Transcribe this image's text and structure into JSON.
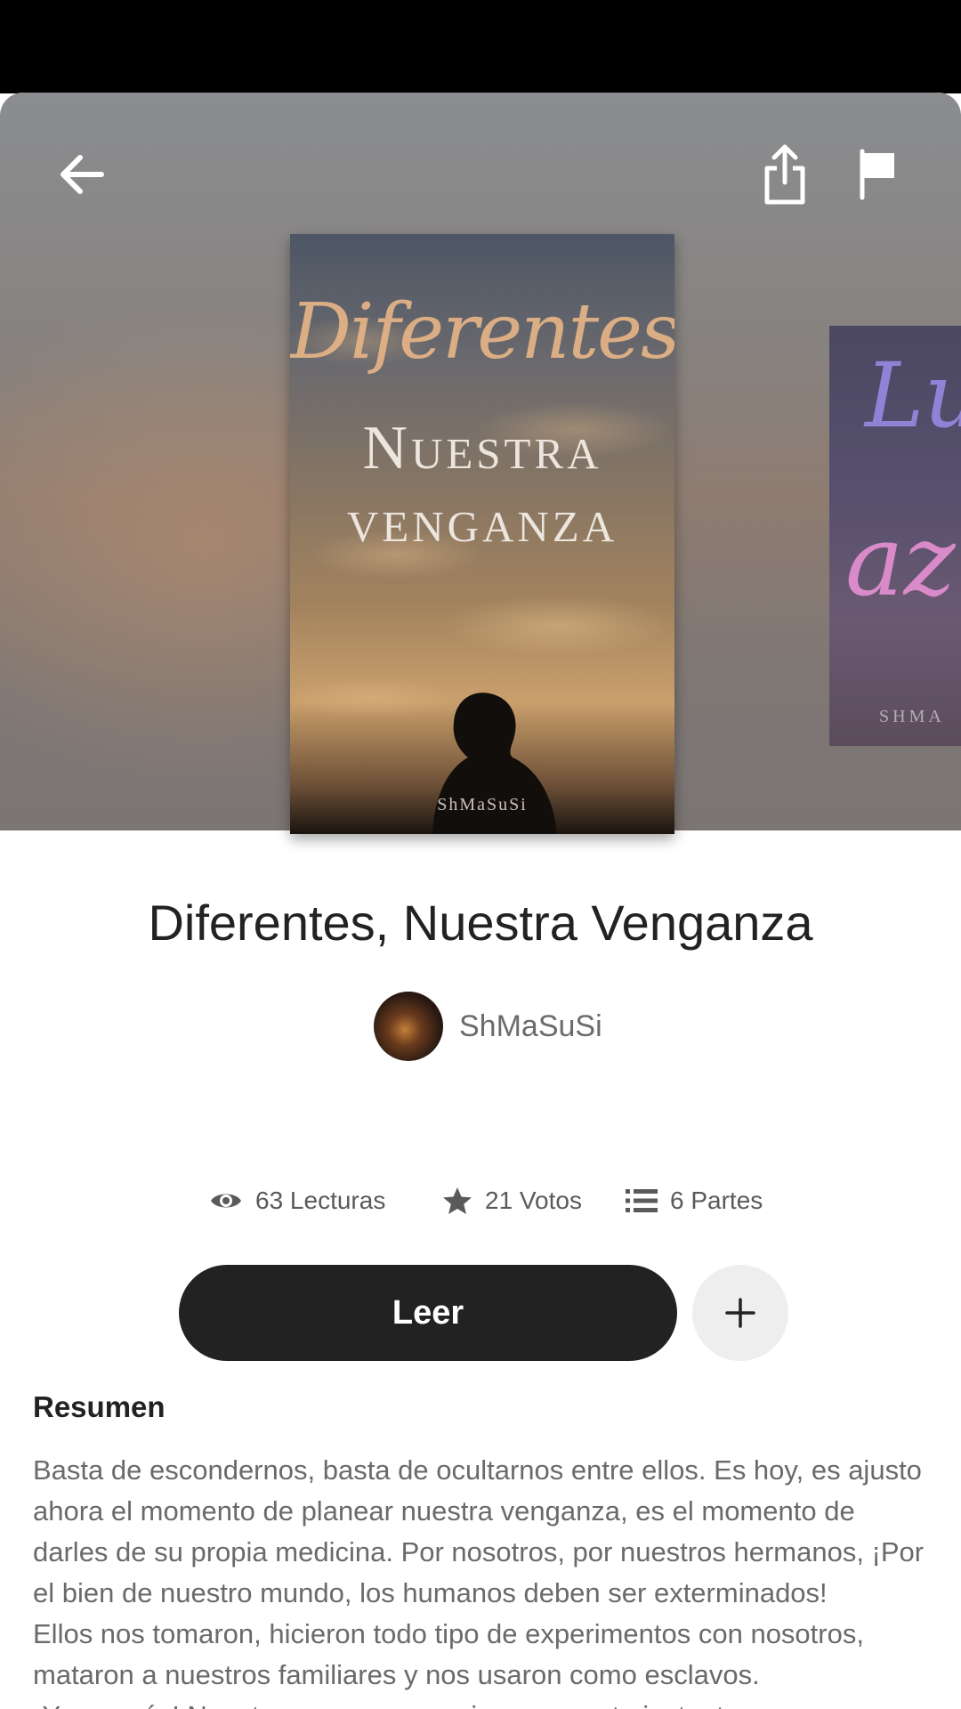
{
  "story": {
    "title": "Diferentes, Nuestra Venganza",
    "author": "ShMaSuSi"
  },
  "cover": {
    "script_text": "Diferentes",
    "title_line1": "Nuestra",
    "title_line2": "venganza",
    "author": "ShMaSuSi"
  },
  "next_cover": {
    "letters_top": "Lu",
    "letters_bottom": "az",
    "author_partial": "SHMA"
  },
  "stats": {
    "reads": "63 Lecturas",
    "votes": "21 Votos",
    "parts": "6 Partes"
  },
  "actions": {
    "read_label": "Leer"
  },
  "summary": {
    "heading": "Resumen",
    "paragraphs": [
      "Basta de escondernos, basta de ocultarnos entre ellos. Es hoy, es ajusto ahora el momento de planear nuestra venganza, es el momento de darles de su propia medicina. Por nosotros, por nuestros hermanos, ¡Por el bien de nuestro mundo, los humanos deben ser exterminados!",
      "Ellos nos tomaron, hicieron todo tipo de experimentos con nosotros, mataron a nuestros familiares y nos usaron como esclavos.",
      "¡Ya no más! Nuestra venganza comienza en este instante."
    ]
  },
  "icons": {
    "back": "arrow-left-icon",
    "share": "share-icon",
    "report": "flag-icon",
    "reads": "eye-icon",
    "votes": "star-icon",
    "parts": "list-icon",
    "add": "plus-icon"
  }
}
